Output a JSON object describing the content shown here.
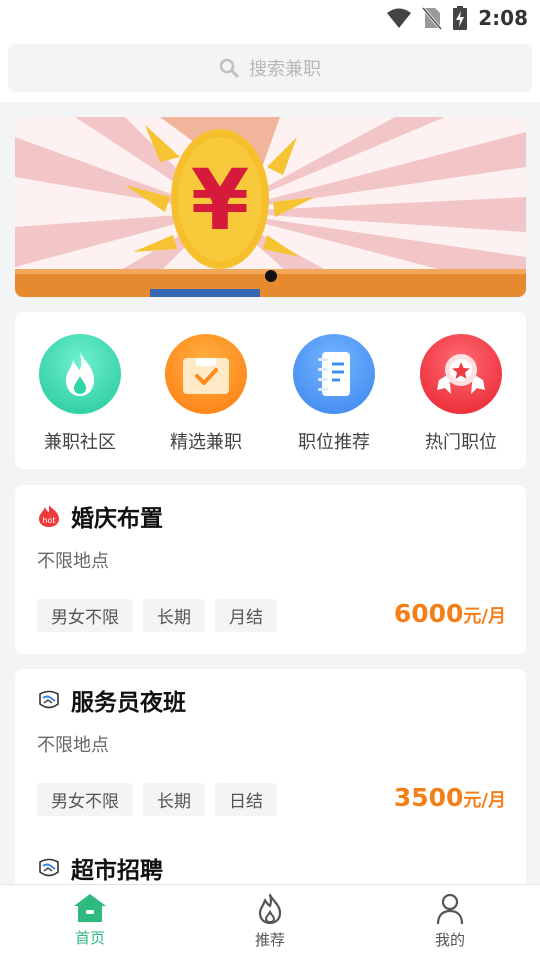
{
  "status": {
    "time": "2:08"
  },
  "search": {
    "placeholder": "搜索兼职"
  },
  "banner": {
    "glyph": "¥"
  },
  "quick_nav": [
    {
      "label": "兼职社区",
      "icon": "flame-icon",
      "color": "#2fd6a8"
    },
    {
      "label": "精选兼职",
      "icon": "clipboard-check-icon",
      "color": "#ff8a1d"
    },
    {
      "label": "职位推荐",
      "icon": "notebook-icon",
      "color": "#3f8ff5"
    },
    {
      "label": "热门职位",
      "icon": "award-badge-icon",
      "color": "#f03a45"
    }
  ],
  "jobs": [
    {
      "badge": "hot",
      "title": "婚庆布置",
      "location": "不限地点",
      "tags": [
        "男女不限",
        "长期",
        "月结"
      ],
      "salary": "6000",
      "unit": "元/月"
    },
    {
      "badge": "",
      "title": "服务员夜班",
      "location": "不限地点",
      "tags": [
        "男女不限",
        "长期",
        "日结"
      ],
      "salary": "3500",
      "unit": "元/月"
    },
    {
      "badge": "",
      "title": "超市招聘"
    }
  ],
  "tabs": [
    {
      "label": "首页",
      "icon": "home-icon",
      "active": true
    },
    {
      "label": "推荐",
      "icon": "flame-outline-icon",
      "active": false
    },
    {
      "label": "我的",
      "icon": "person-icon",
      "active": false
    }
  ],
  "colors": {
    "accent": "#2fba7e",
    "salary": "#f57f17"
  }
}
